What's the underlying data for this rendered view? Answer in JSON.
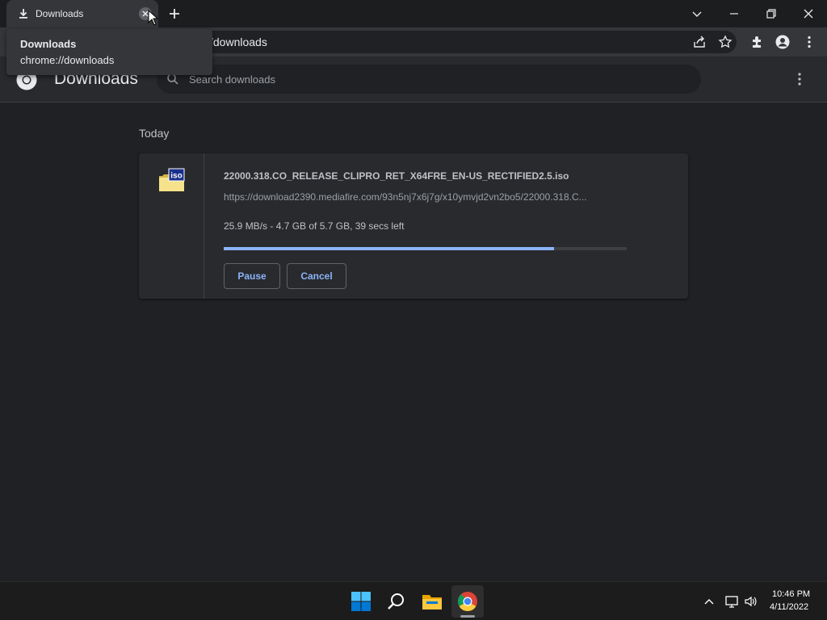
{
  "tab": {
    "title": "Downloads"
  },
  "omnibox": {
    "url": "chrome://downloads",
    "visible_text": "/downloads"
  },
  "tooltip": {
    "title": "Downloads",
    "url": "chrome://downloads"
  },
  "downloads_page": {
    "title": "Downloads",
    "search_placeholder": "Search downloads",
    "date_group": "Today",
    "item": {
      "file_name": "22000.318.CO_RELEASE_CLIPRO_RET_X64FRE_EN-US_RECTIFIED2.5.iso",
      "url": "https://download2390.mediafire.com/93n5nj7x6j7g/x10ymvjd2vn2bo5/22000.318.C...",
      "progress_text": "25.9 MB/s - 4.7 GB of 5.7 GB, 39 secs left",
      "progress_fraction": 0.82,
      "icon_label": "iso",
      "pause_label": "Pause",
      "cancel_label": "Cancel"
    }
  },
  "colors": {
    "accent": "#8ab4f8",
    "background": "#202124",
    "surface": "#292a2d"
  },
  "taskbar": {
    "apps": [
      "start-icon",
      "search-icon",
      "file-explorer-icon",
      "chrome-icon"
    ],
    "clock_time": "10:46 PM",
    "clock_date": "4/11/2022"
  }
}
